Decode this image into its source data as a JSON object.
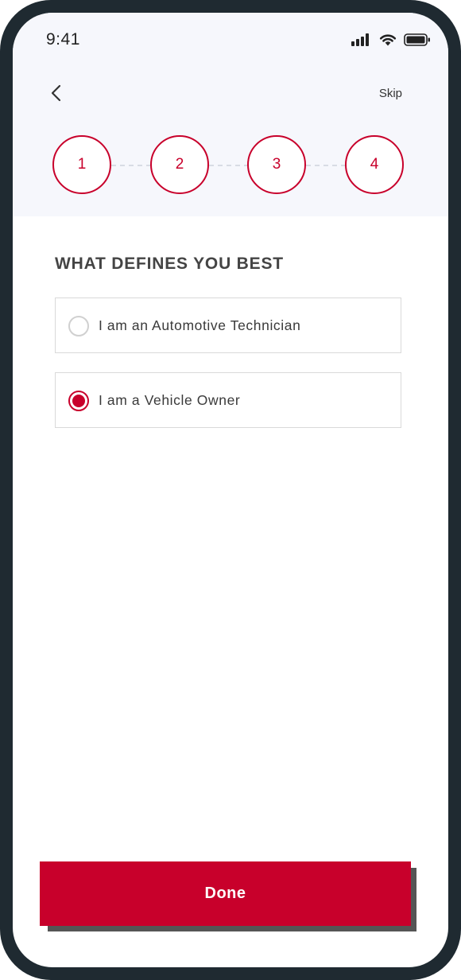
{
  "status_bar": {
    "time": "9:41",
    "icons": [
      "cellular-signal-icon",
      "wifi-icon",
      "battery-icon"
    ]
  },
  "header": {
    "back_icon": "chevron-left-icon",
    "skip_label": "Skip"
  },
  "stepper": {
    "steps": [
      "1",
      "2",
      "3",
      "4"
    ]
  },
  "question": {
    "title": "WHAT DEFINES YOU BEST",
    "options": [
      {
        "label": "I am an Automotive Technician",
        "selected": false
      },
      {
        "label": "I am a Vehicle Owner",
        "selected": true
      }
    ]
  },
  "footer": {
    "done_label": "Done"
  },
  "colors": {
    "accent": "#c8002b",
    "frame": "#1f2a31",
    "header_bg": "#f6f7fc",
    "title_text": "#444444"
  }
}
